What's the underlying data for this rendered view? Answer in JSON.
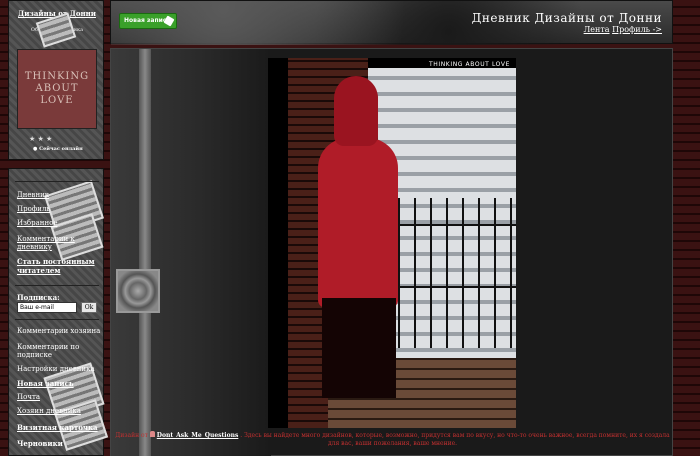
{
  "sidebar": {
    "owner_title": "Дизайны от Донни",
    "owner_subtitle": "Оболочка дневника",
    "avatar_text": "THINKING ABOUT LOVE",
    "rating": "★ ★ ★",
    "online": "Сейчас онлайн",
    "nav": [
      {
        "label": "Дневник"
      },
      {
        "label": "Профиль"
      },
      {
        "label": "Избранное"
      },
      {
        "label": "Комментарии к дневнику"
      },
      {
        "label": "Стать постоянным читателем"
      }
    ],
    "subscribe_label": "Подписка:",
    "email_placeholder": "Ваш e-mail",
    "ok_label": "Ok",
    "links": [
      {
        "label": "Комментарии хозяина"
      },
      {
        "label": "Комментарии по подписке"
      },
      {
        "label": "Настройки дневника"
      },
      {
        "label": "Новая запись"
      },
      {
        "label": "Почта"
      },
      {
        "label": "Хозяин дневника"
      },
      {
        "label": "Визитная карточка"
      },
      {
        "label": "Черновики"
      }
    ]
  },
  "header": {
    "new_post": "Новая запись",
    "diary_title": "Дневник Дизайны от Донни",
    "feed_link": "Лента",
    "profile_link": "Профиль ->"
  },
  "post": {
    "picture_title": "THINKING ABOUT LOVE",
    "caption_prefix": "Дизайн от",
    "caption_author": "Dont_Ask_Me_Questions",
    "caption_text": ". Здесь вы найдете много дизайнов, которые, возможно, придутся вам по вкусу, но что-то очень важное, всегда помните, их я создала для вас, ваши пожелания, ваше мнение."
  }
}
